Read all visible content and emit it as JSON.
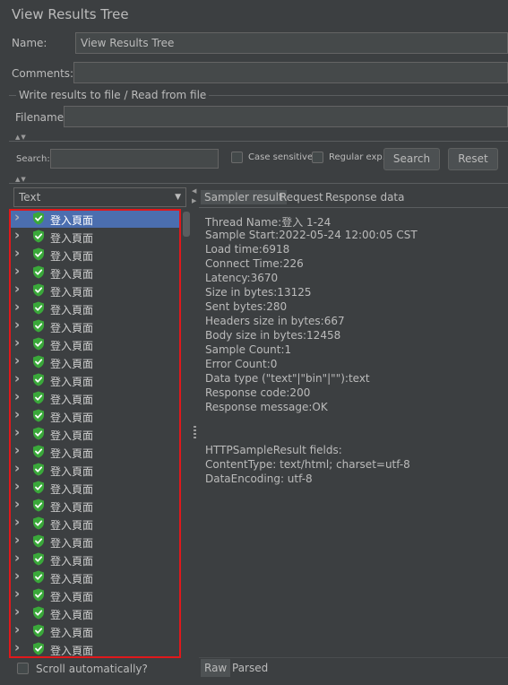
{
  "title": "View Results Tree",
  "name_label": "Name:",
  "name_value": "View Results Tree",
  "comments_label": "Comments:",
  "comments_value": "",
  "write_group_label": "Write results to file / Read from file",
  "filename_label": "Filename",
  "filename_value": "",
  "search": {
    "label": "Search:",
    "value": "",
    "case_sensitive_label": "Case sensitive",
    "regular_exp_label": "Regular exp.",
    "search_button": "Search",
    "reset_button": "Reset"
  },
  "renderer_select": "Text",
  "tree_items": [
    "登入頁面",
    "登入頁面",
    "登入頁面",
    "登入頁面",
    "登入頁面",
    "登入頁面",
    "登入頁面",
    "登入頁面",
    "登入頁面",
    "登入頁面",
    "登入頁面",
    "登入頁面",
    "登入頁面",
    "登入頁面",
    "登入頁面",
    "登入頁面",
    "登入頁面",
    "登入頁面",
    "登入頁面",
    "登入頁面",
    "登入頁面",
    "登入頁面",
    "登入頁面",
    "登入頁面",
    "登入頁面"
  ],
  "selected_index": 0,
  "tabs": [
    "Sampler result",
    "Request",
    "Response data"
  ],
  "sampler_result": [
    "Thread Name:登入 1-24",
    "Sample Start:2022-05-24 12:00:05 CST",
    "Load time:6918",
    "Connect Time:226",
    "Latency:3670",
    "Size in bytes:13125",
    "Sent bytes:280",
    "Headers size in bytes:667",
    "Body size in bytes:12458",
    "Sample Count:1",
    "Error Count:0",
    "Data type (\"text\"|\"bin\"|\"\"):text",
    "Response code:200",
    "Response message:OK",
    "",
    "",
    "HTTPSampleResult fields:",
    "ContentType: text/html; charset=utf-8",
    "DataEncoding: utf-8"
  ],
  "scroll_auto_label": "Scroll automatically?",
  "bottom_tabs": [
    "Raw",
    "Parsed"
  ],
  "colors": {
    "background": "#3c3f41",
    "selection": "#4b6eaf",
    "highlight_box": "#e0181b",
    "shield": "#3aa83a"
  }
}
